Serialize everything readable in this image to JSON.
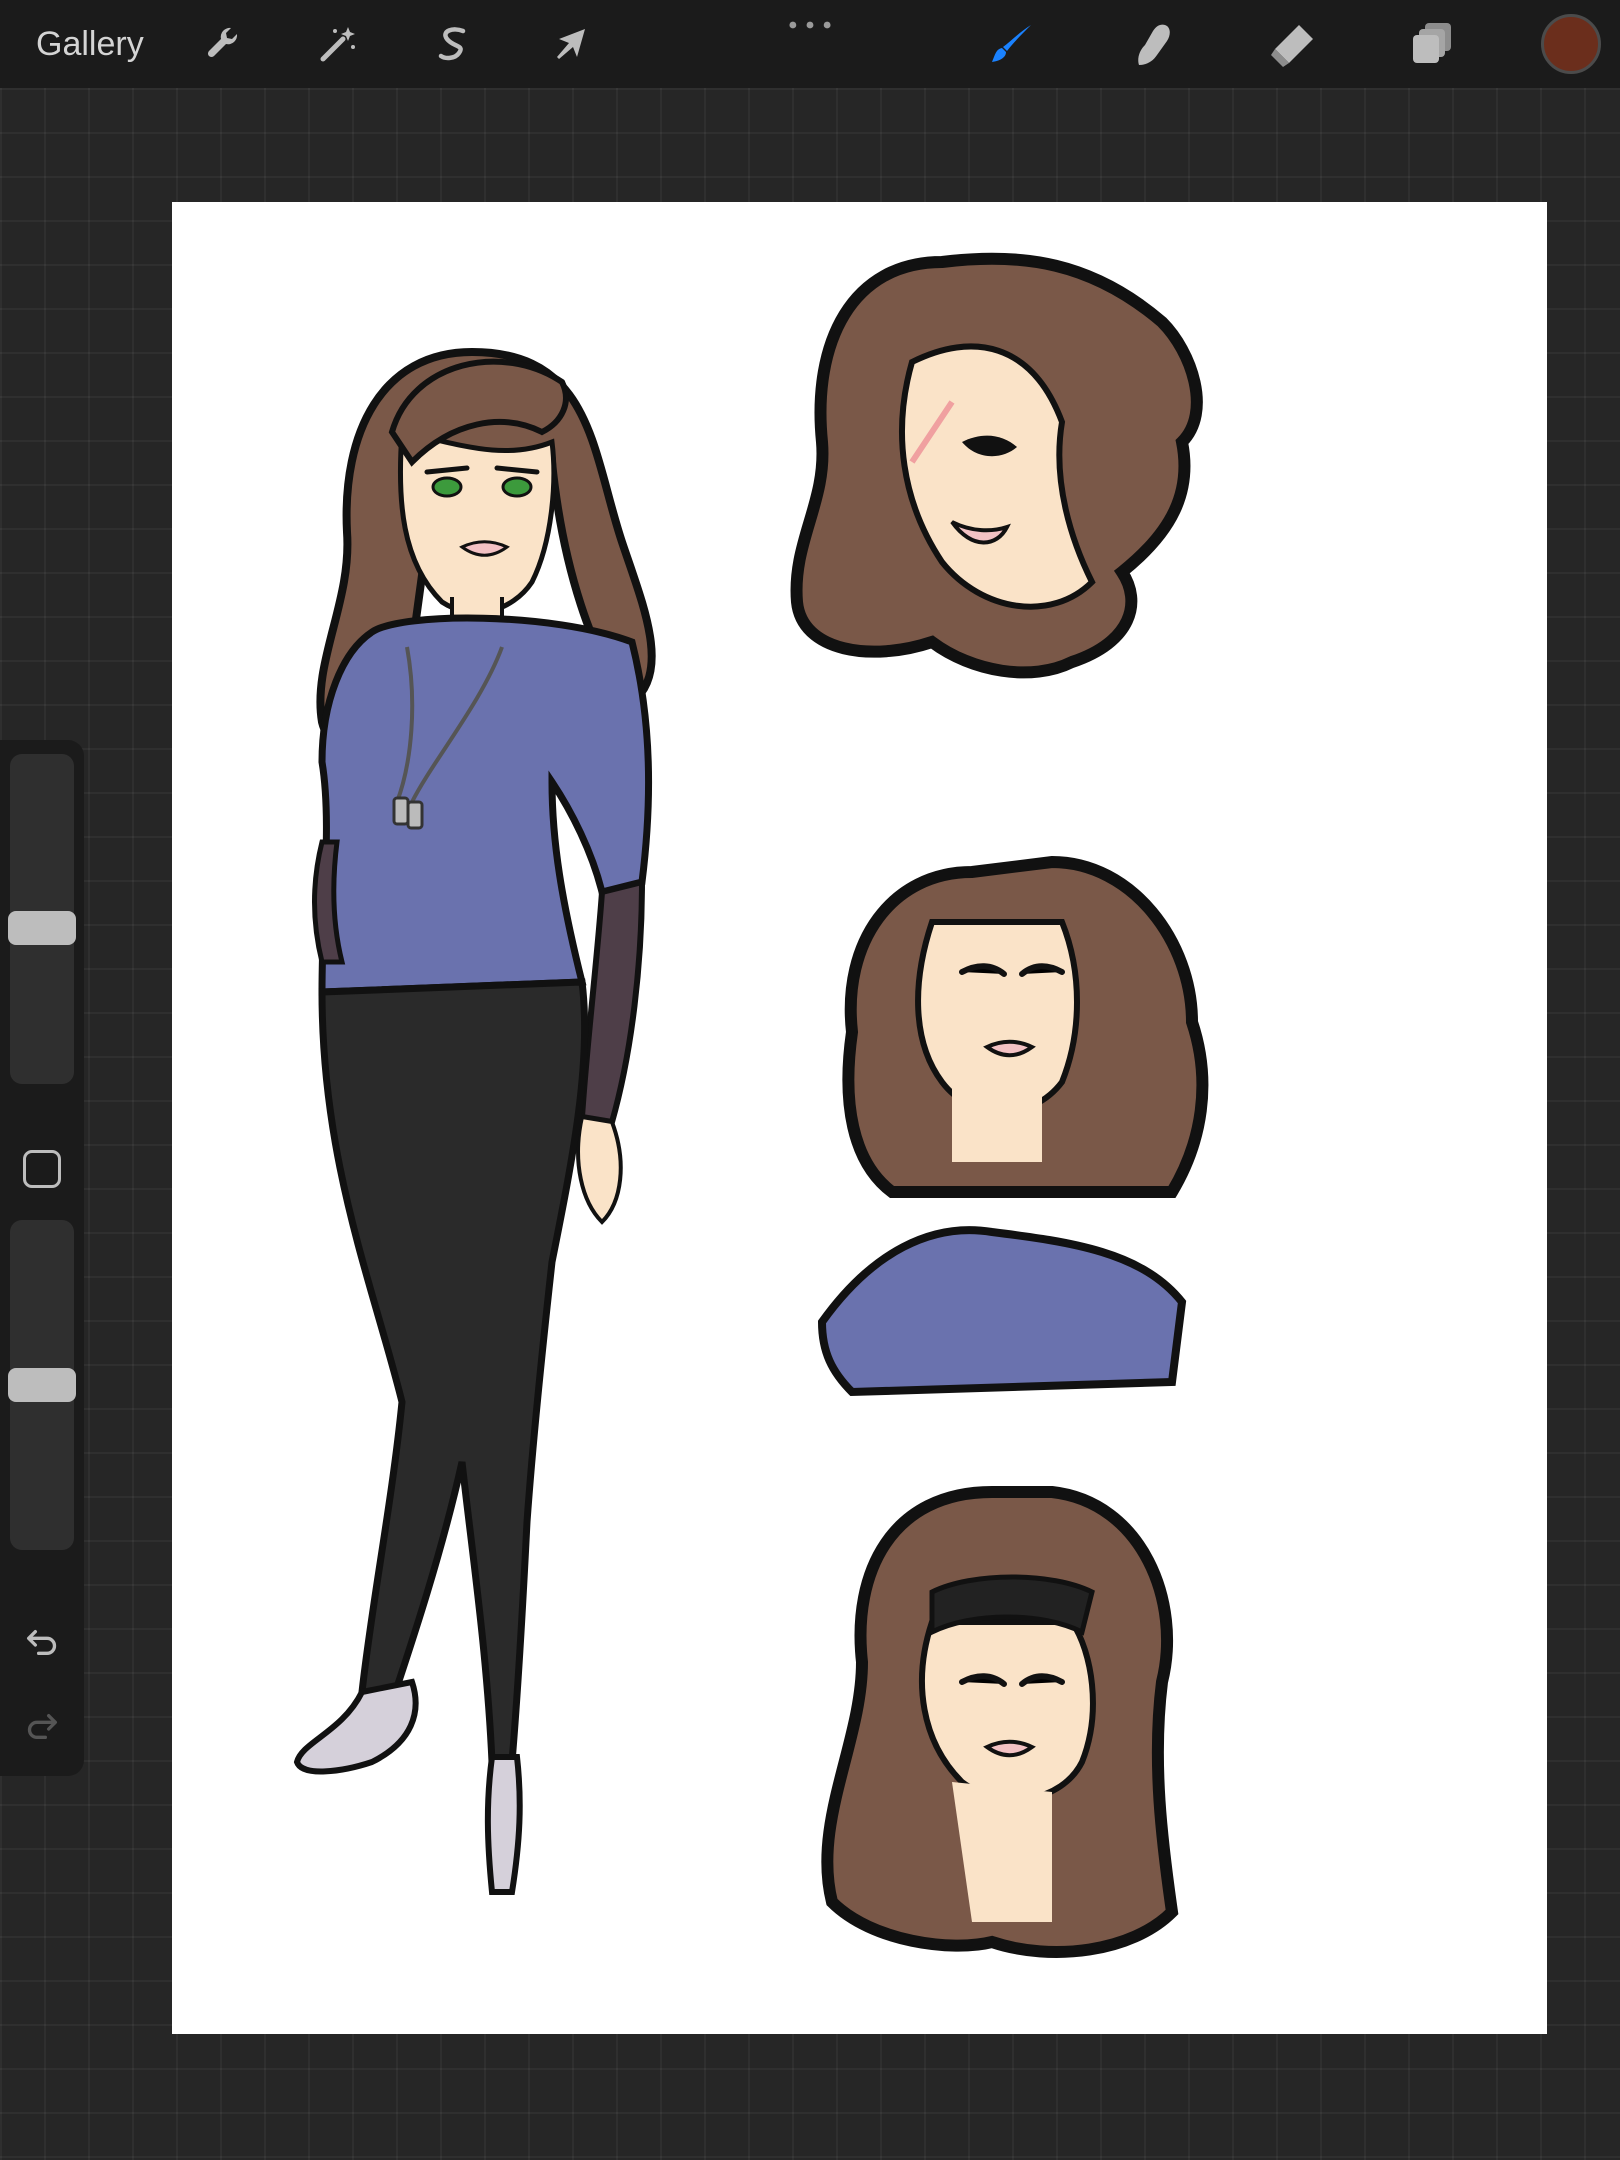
{
  "toolbar": {
    "gallery_label": "Gallery",
    "left_tools": [
      {
        "name": "actions",
        "icon": "wrench-icon"
      },
      {
        "name": "adjustments",
        "icon": "magic-wand-icon"
      },
      {
        "name": "selection",
        "icon": "selection-s-icon"
      },
      {
        "name": "transform",
        "icon": "cursor-arrow-icon"
      }
    ],
    "more_icon": "more-dots-icon",
    "right_tools": [
      {
        "name": "brush",
        "icon": "brush-icon",
        "active": true
      },
      {
        "name": "smudge",
        "icon": "smudge-finger-icon",
        "active": false
      },
      {
        "name": "eraser",
        "icon": "eraser-icon",
        "active": false
      },
      {
        "name": "layers",
        "icon": "layers-icon",
        "active": false
      }
    ],
    "current_color": "#6b2e1c",
    "active_tool_color": "#1a82ff"
  },
  "sidebar": {
    "brush_size_level": 0.47,
    "opacity_level": 0.5,
    "modifier_icon": "square-modifier-icon",
    "undo_icon": "undo-icon",
    "redo_icon": "redo-icon",
    "redo_enabled": false
  },
  "canvas": {
    "background": "#ffffff",
    "palette": {
      "hair": "#7a5848",
      "skin": "#fae3c8",
      "shirt": "#6a72ae",
      "pants": "#2a2a2a",
      "sleeve": "#4e3e48",
      "lips": "#f3c2c4",
      "eyes": "#3c9a3c",
      "outline": "#111111"
    }
  }
}
